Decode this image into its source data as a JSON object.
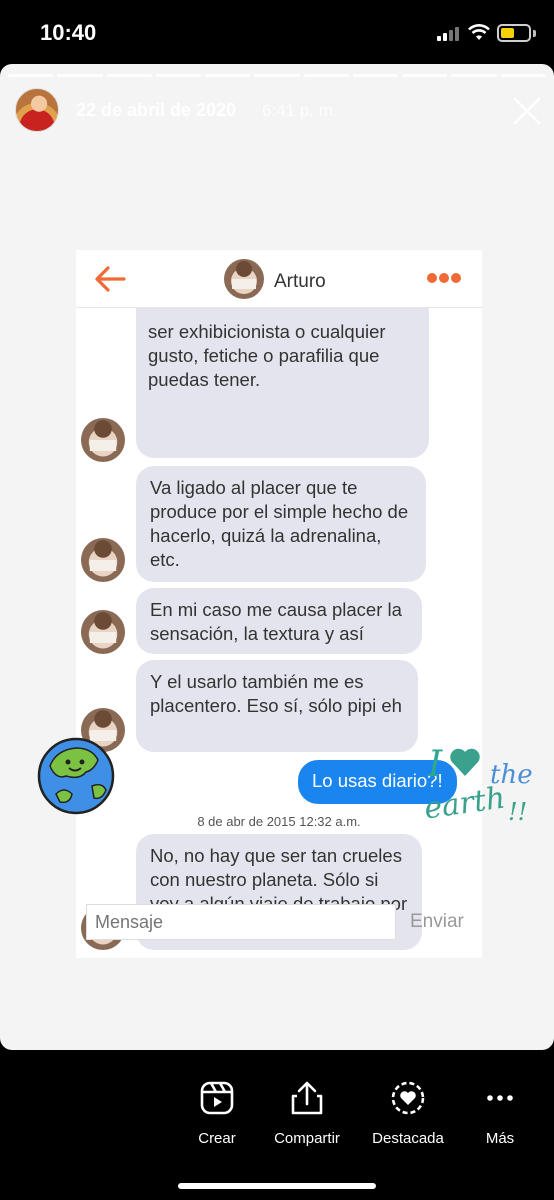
{
  "status_bar": {
    "time": "10:40"
  },
  "story": {
    "date": "22 de abril de 2020",
    "time": "6:41 p. m."
  },
  "chat": {
    "contact_name": "Arturo",
    "messages": [
      {
        "text": "ser exhibicionista o cualquier gusto, fetiche o parafilia que puedas tener."
      },
      {
        "text": "Va ligado al placer que te produce por el simple hecho de hacerlo, quizá la adrenalina, etc."
      },
      {
        "text": "En mi caso me causa placer la sensación, la textura y así"
      },
      {
        "text": "Y el usarlo también me es placentero. Eso sí, sólo pipi eh"
      },
      {
        "text": "Lo usas diario?!"
      },
      {
        "text": "No, no hay que ser tan crueles con nuestro planeta. Sólo si voy a algún viaje de trabajo por ejemplo."
      }
    ],
    "timestamp": "8 de abr de 2015 12:32 a.m.",
    "input_placeholder": "Mensaje",
    "send_label": "Enviar",
    "accent_color": "#f06a35",
    "outgoing_color": "#1a85ef"
  },
  "sticker": {
    "text_line1": "I",
    "text_line2": "the",
    "text_line3": "earth",
    "text_line4": "!!"
  },
  "actions": [
    {
      "label": "Crear",
      "icon": "reels-icon"
    },
    {
      "label": "Compartir",
      "icon": "share-icon"
    },
    {
      "label": "Destacada",
      "icon": "highlight-icon"
    },
    {
      "label": "Más",
      "icon": "more-icon"
    }
  ]
}
